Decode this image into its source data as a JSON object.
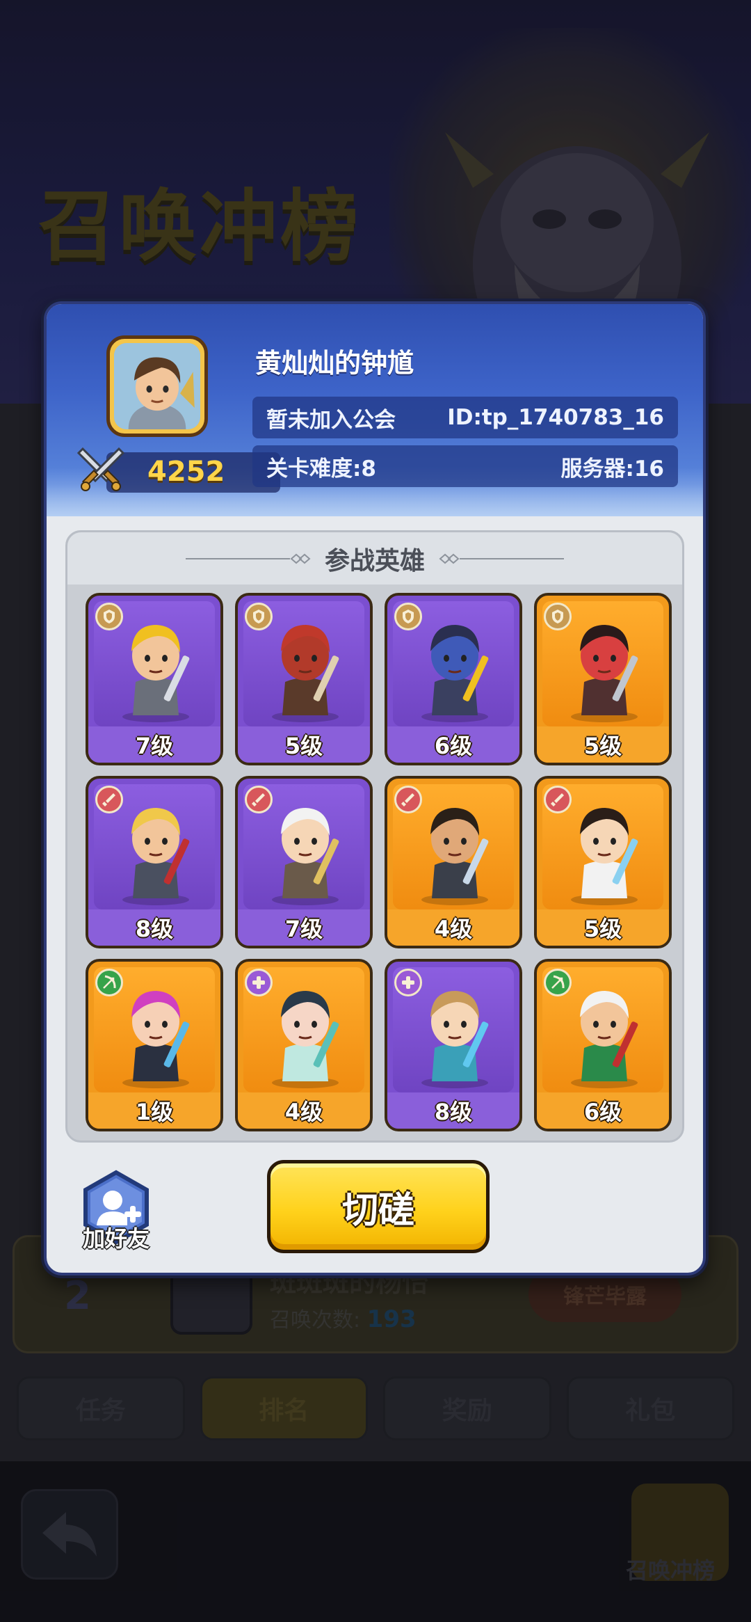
{
  "background": {
    "title": "召唤冲榜",
    "row": {
      "rank": "2",
      "name": "斑斑斑的杨怡",
      "count_label": "召唤次数:",
      "count_value": "193",
      "badge": "锋芒毕露"
    },
    "tabs": [
      "任务",
      "排名",
      "奖励",
      "礼包"
    ],
    "summon_label": "召唤冲榜"
  },
  "profile": {
    "name": "黄灿灿的钟馗",
    "guild": "暂未加入公会",
    "id": "ID:tp_1740783_16",
    "stage_difficulty": "关卡难度:8",
    "server": "服务器:16",
    "power": "4252"
  },
  "heroes_section": {
    "title": "参战英雄",
    "heroes": [
      {
        "level": "7级",
        "rarity": "purple",
        "class": "tank",
        "theme": "viking",
        "icon": "viking-dwarf-hero-icon"
      },
      {
        "level": "5级",
        "rarity": "purple",
        "class": "tank",
        "theme": "boar",
        "icon": "red-boar-warrior-hero-icon"
      },
      {
        "level": "6级",
        "rarity": "purple",
        "class": "tank",
        "theme": "minotaur",
        "icon": "blue-minotaur-hero-icon"
      },
      {
        "level": "5级",
        "rarity": "orange",
        "class": "tank",
        "theme": "oni",
        "icon": "red-oni-axe-hero-icon"
      },
      {
        "level": "8级",
        "rarity": "purple",
        "class": "warrior",
        "theme": "knight",
        "icon": "blonde-knight-hero-icon"
      },
      {
        "level": "7级",
        "rarity": "purple",
        "class": "warrior",
        "theme": "swordsman",
        "icon": "white-hair-swordsman-hero-icon"
      },
      {
        "level": "4级",
        "rarity": "orange",
        "class": "warrior",
        "theme": "samurai",
        "icon": "bearded-samurai-hero-icon"
      },
      {
        "level": "5级",
        "rarity": "orange",
        "class": "warrior",
        "theme": "swordswoman",
        "icon": "swordswoman-hero-icon"
      },
      {
        "level": "1级",
        "rarity": "orange",
        "class": "archer",
        "theme": "gunner",
        "icon": "pink-hair-gunner-hero-icon"
      },
      {
        "level": "4级",
        "rarity": "orange",
        "class": "healer",
        "theme": "fairy",
        "icon": "teal-fairy-hero-icon"
      },
      {
        "level": "8级",
        "rarity": "purple",
        "class": "healer",
        "theme": "mage",
        "icon": "staff-mage-hero-icon"
      },
      {
        "level": "6级",
        "rarity": "orange",
        "class": "archer",
        "theme": "elder",
        "icon": "elder-general-hero-icon"
      }
    ]
  },
  "actions": {
    "add_friend": "加好友",
    "spar": "切磋"
  },
  "colors": {
    "purple_card": "#7b4fd0",
    "orange_card": "#f29a1c",
    "button_yellow": "#ffd21c",
    "header_blue": "#3d63c8",
    "power_gold": "#ffd54a"
  }
}
